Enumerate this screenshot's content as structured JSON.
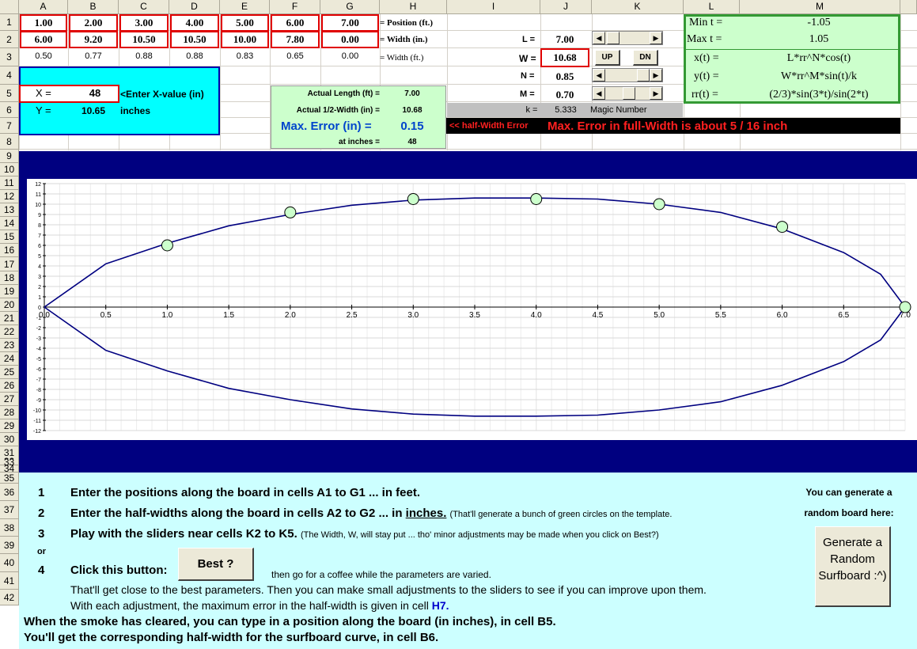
{
  "columns": [
    "A",
    "B",
    "C",
    "D",
    "E",
    "F",
    "G",
    "H",
    "I",
    "J",
    "K",
    "L",
    "M"
  ],
  "rows": [
    "1",
    "2",
    "3",
    "4",
    "5",
    "6",
    "7",
    "8",
    "9",
    "10",
    "11",
    "12",
    "13",
    "14",
    "15",
    "16",
    "17",
    "18",
    "19",
    "20",
    "21",
    "22",
    "23",
    "24",
    "25",
    "26",
    "27",
    "28",
    "29",
    "30",
    "31",
    "32",
    "33",
    "34",
    "35",
    "36",
    "37",
    "38",
    "39",
    "40",
    "41",
    "42"
  ],
  "positions": [
    "1.00",
    "2.00",
    "3.00",
    "4.00",
    "5.00",
    "6.00",
    "7.00"
  ],
  "widths_in": [
    "6.00",
    "9.20",
    "10.50",
    "10.50",
    "10.00",
    "7.80",
    "0.00"
  ],
  "widths_ft": [
    "0.50",
    "0.77",
    "0.88",
    "0.88",
    "0.83",
    "0.65",
    "0.00"
  ],
  "label_position": "= Position (ft.)",
  "label_width_in": "= Width (in.)",
  "label_width_ft": "= Width (ft.)",
  "params": {
    "L_label": "L =",
    "L_value": "7.00",
    "W_label": "W =",
    "W_value": "10.68",
    "N_label": "N =",
    "N_value": "0.85",
    "M_label": "M =",
    "M_value": "0.70",
    "k_label": "k =",
    "k_value": "5.333",
    "magic": "Magic Number",
    "up_label": "UP",
    "dn_label": "DN"
  },
  "formulas": {
    "min_t_label": "Min t =",
    "min_t_value": "-1.05",
    "max_t_label": "Max t =",
    "max_t_value": "1.05",
    "x_label": "x(t) =",
    "x_expr": "L*rr^N*cos(t)",
    "y_label": "y(t) =",
    "y_expr": "W*rr^M*sin(t)/k",
    "rr_label": "rr(t) =",
    "rr_expr": "(2/3)*sin(3*t)/sin(2*t)"
  },
  "xy_box": {
    "x_label": "X =",
    "x_value": "48",
    "x_hint": "<Enter X-value (in)",
    "y_label": "Y =",
    "y_value": "10.65",
    "y_unit": "inches"
  },
  "summary": {
    "actual_length_label": "Actual Length (ft) =",
    "actual_length_value": "7.00",
    "actual_half_width_label": "Actual 1/2-Width (in) =",
    "actual_half_width_value": "10.68",
    "max_error_label": "Max. Error (in) =",
    "max_error_value": "0.15",
    "at_inches_label": "at inches =",
    "at_inches_value": "48"
  },
  "error_banner": {
    "half_width_note": "<< half-Width Error",
    "full_width_note": "Max. Error in full-Width is about 5 / 16 inch"
  },
  "chart_data": {
    "type": "scatter",
    "title": "",
    "xlabel": "",
    "ylabel": "",
    "xlim": [
      0,
      7
    ],
    "ylim": [
      -12,
      12
    ],
    "x_ticks": [
      "0.0",
      "0.5",
      "1.0",
      "1.5",
      "2.0",
      "2.5",
      "3.0",
      "3.5",
      "4.0",
      "4.5",
      "5.0",
      "5.5",
      "6.0",
      "6.5",
      "7.0"
    ],
    "y_ticks": [
      "12",
      "11",
      "10",
      "9",
      "8",
      "7",
      "6",
      "5",
      "4",
      "3",
      "2",
      "1",
      "0",
      "-1",
      "-2",
      "-3",
      "-4",
      "-5",
      "-6",
      "-7",
      "-8",
      "-9",
      "-10",
      "-11",
      "-12"
    ],
    "grid": true,
    "series": [
      {
        "type": "scatter",
        "x": [
          1,
          2,
          3,
          4,
          5,
          6,
          7
        ],
        "y": [
          6.0,
          9.2,
          10.5,
          10.5,
          10.0,
          7.8,
          0.0
        ],
        "color": "#ccffcc"
      },
      {
        "type": "line",
        "closed": true,
        "x": [
          0,
          0.5,
          1,
          1.5,
          2,
          2.5,
          3,
          3.5,
          4,
          4.5,
          5,
          5.5,
          6,
          6.5,
          6.8,
          7,
          6.8,
          6.5,
          6,
          5.5,
          5,
          4.5,
          4,
          3.5,
          3,
          2.5,
          2,
          1.5,
          1,
          0.5,
          0
        ],
        "y": [
          0,
          4.2,
          6.2,
          7.9,
          9.0,
          9.9,
          10.4,
          10.6,
          10.6,
          10.5,
          10.0,
          9.2,
          7.6,
          5.3,
          3.2,
          0,
          -3.2,
          -5.3,
          -7.6,
          -9.2,
          -10.0,
          -10.5,
          -10.6,
          -10.6,
          -10.4,
          -9.9,
          -9.0,
          -7.9,
          -6.2,
          -4.2,
          0
        ],
        "color": "#000080"
      }
    ]
  },
  "instructions": {
    "n1": "1",
    "t1": "Enter the positions along the board in cells A1 to G1 ... in feet.",
    "n2": "2",
    "t2a": "Enter the half-widths along the board in cells A2 to G2 ... in",
    "t2b": "inches.",
    "t2c": "(That'll generate a bunch of green circles on the template.",
    "n3": "3",
    "t3a": "Play with the sliders near cells K2 to K5.",
    "t3b": "(The Width, W, will stay put ... tho' minor adjustments may be made when you click on Best?)",
    "or": "or",
    "n4": "4",
    "t4": "Click this button:",
    "best": "Best ?",
    "t4b": "then go for a coffee while the parameters are varied.",
    "l39": "That'll get close to the best parameters. Then you can make small adjustments to the sliders to see if you can improve upon them.",
    "l40a": "With each adjustment, the maximum error in the half-width is given in cell",
    "l40b": "H7.",
    "l41": "When the smoke has cleared, you can type in a position along the board (in inches), in cell B5.",
    "l42": "You'll get the corresponding half-width for the surfboard curve, in cell B6.",
    "random_note1": "You can generate a",
    "random_note2": "random board here:",
    "random_button": "Generate a Random Surfboard :^)"
  }
}
